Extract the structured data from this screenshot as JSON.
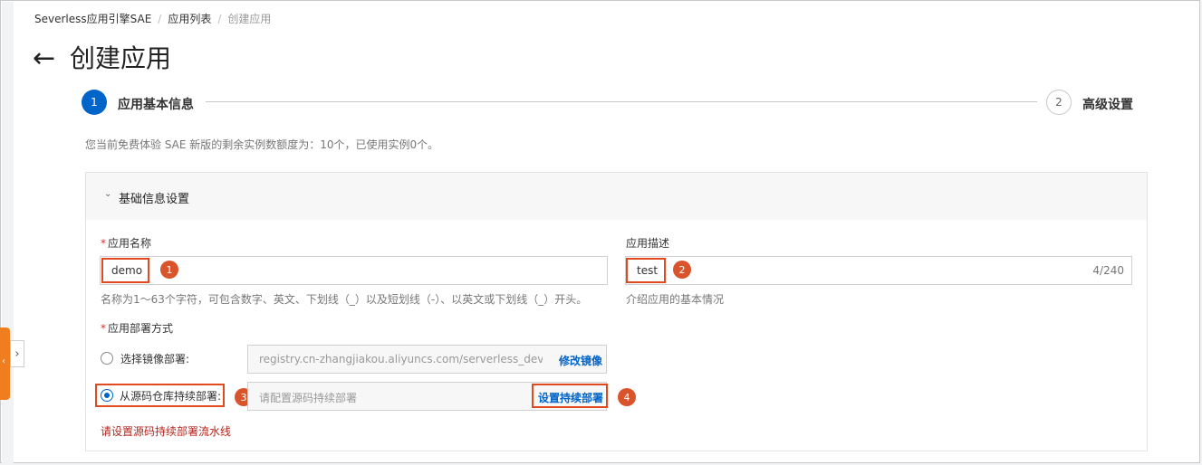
{
  "breadcrumb": {
    "item1": "Severless应用引擎SAE",
    "item2": "应用列表",
    "item3": "创建应用"
  },
  "header": {
    "back_icon": "arrow-left-icon",
    "title": "创建应用"
  },
  "steps": [
    {
      "number": "1",
      "label": "应用基本信息"
    },
    {
      "number": "2",
      "label": "高级设置"
    }
  ],
  "quota_notice": "您当前免费体验 SAE 新版的剩余实例数额度为：10个，已使用实例0个。",
  "section": {
    "title": "基础信息设置"
  },
  "form": {
    "app_name_label": "应用名称",
    "app_name_value": "demo",
    "app_name_help": "名称为1～63个字符，可包含数字、英文、下划线（_）以及短划线（-）、以英文或下划线（_）开头。",
    "app_desc_label": "应用描述",
    "app_desc_value": "test",
    "app_desc_count": "4/240",
    "app_desc_help": "介绍应用的基本情况",
    "deploy_label": "应用部署方式",
    "option_image_label": "选择镜像部署:",
    "option_image_placeholder": "registry.cn-zhangjiakou.aliyuncs.com/serverless_devs/sae-de",
    "option_image_action": "修改镜像",
    "option_repo_label": "从源码仓库持续部署:",
    "option_repo_placeholder": "请配置源码持续部署",
    "option_repo_action": "设置持续部署",
    "error_text": "请设置源码持续部署流水线"
  },
  "annotations": [
    "1",
    "2",
    "3",
    "4"
  ],
  "colors": {
    "accent": "#0064c8",
    "highlight": "#e04a1e",
    "sidebar_tab": "#f07d1e"
  }
}
